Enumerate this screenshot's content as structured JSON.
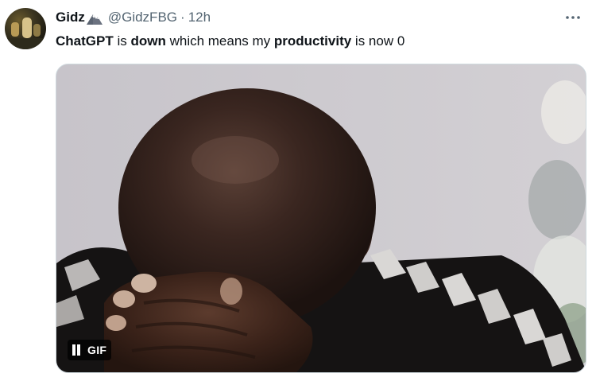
{
  "tweet": {
    "author": {
      "display_name": "Gidz",
      "handle": "@GidzFBG",
      "badge_icon": "mountain-emoji-icon",
      "avatar_icon": "avatar"
    },
    "separator": "·",
    "time": "12h",
    "more_icon": "more-horizontal-icon",
    "text": {
      "part1": "ChatGPT",
      "part2": " is ",
      "part3": "down",
      "part4": " which means my ",
      "part5": "productivity",
      "part6": " is now 0"
    },
    "media": {
      "type": "gif",
      "badge_label": "GIF",
      "pause_icon": "pause-icon"
    }
  }
}
